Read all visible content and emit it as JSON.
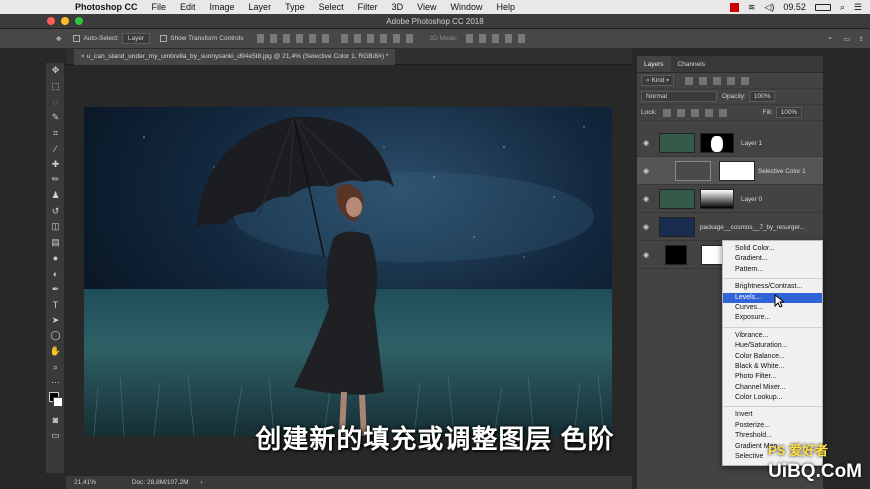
{
  "mac_menu": {
    "app_name": "Photoshop CC",
    "items": [
      "File",
      "Edit",
      "Image",
      "Layer",
      "Type",
      "Select",
      "Filter",
      "3D",
      "View",
      "Window",
      "Help"
    ],
    "clock": "09.52"
  },
  "window": {
    "title": "Adobe Photoshop CC 2018"
  },
  "options_bar": {
    "auto_select_label": "Auto-Select:",
    "auto_select_value": "Layer",
    "transform_label": "Show Transform Controls",
    "mode_label": "3D Mode:"
  },
  "document": {
    "tab_title": "u_can_stand_under_my_umbrella_by_sunnysanki_d94e5t8.jpg @ 21,4% (Selective Color 1, RGB/8#) *",
    "zoom": "21,41%",
    "doc_size": "Doc: 28,8M/107,2M"
  },
  "layers_panel": {
    "tabs": [
      "Layers",
      "Channels"
    ],
    "filter_value": "Kind",
    "blend_mode": "Normal",
    "opacity_label": "Opacity:",
    "opacity_value": "100%",
    "lock_label": "Lock:",
    "fill_label": "Fill:",
    "fill_value": "100%",
    "layers": [
      {
        "name": "Layer 1"
      },
      {
        "name": "Selective Color 1"
      },
      {
        "name": "Layer 0"
      },
      {
        "name": "package__cosmos__7_by_resurger..."
      },
      {
        "name": ""
      }
    ]
  },
  "context_menu": {
    "group1": [
      "Solid Color...",
      "Gradient...",
      "Pattern..."
    ],
    "group2": [
      "Brightness/Contrast...",
      "Levels...",
      "Curves...",
      "Exposure..."
    ],
    "group3": [
      "Vibrance...",
      "Hue/Saturation...",
      "Color Balance...",
      "Black & White...",
      "Photo Filter...",
      "Channel Mixer...",
      "Color Lookup..."
    ],
    "group4": [
      "Invert",
      "Posterize...",
      "Threshold...",
      "Gradient Map...",
      "Selective"
    ],
    "selected": "Levels..."
  },
  "subtitle": "创建新的填充或调整图层 色阶",
  "watermark": {
    "main": "UiBQ.CoM",
    "ps_tag": "PS 爱好者"
  },
  "colors": {
    "selection": "#2f63d6",
    "panel_bg": "#434343"
  }
}
